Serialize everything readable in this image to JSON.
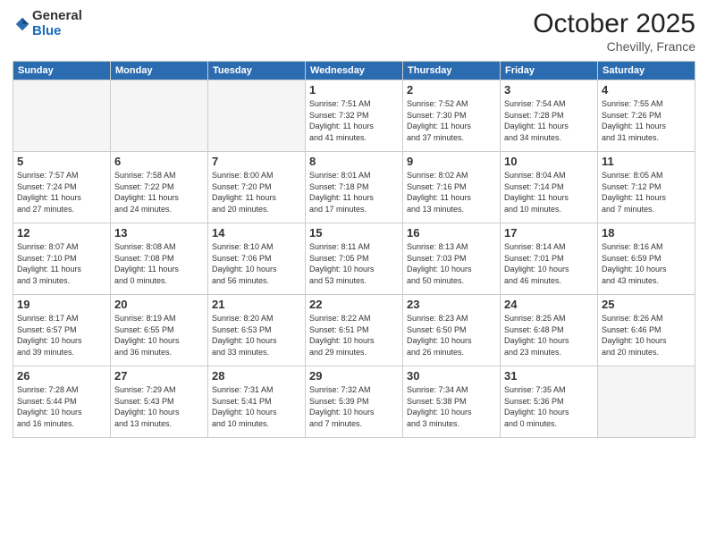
{
  "header": {
    "logo_line1": "General",
    "logo_line2": "Blue",
    "month": "October 2025",
    "location": "Chevilly, France"
  },
  "days_of_week": [
    "Sunday",
    "Monday",
    "Tuesday",
    "Wednesday",
    "Thursday",
    "Friday",
    "Saturday"
  ],
  "weeks": [
    [
      {
        "num": "",
        "info": ""
      },
      {
        "num": "",
        "info": ""
      },
      {
        "num": "",
        "info": ""
      },
      {
        "num": "1",
        "info": "Sunrise: 7:51 AM\nSunset: 7:32 PM\nDaylight: 11 hours\nand 41 minutes."
      },
      {
        "num": "2",
        "info": "Sunrise: 7:52 AM\nSunset: 7:30 PM\nDaylight: 11 hours\nand 37 minutes."
      },
      {
        "num": "3",
        "info": "Sunrise: 7:54 AM\nSunset: 7:28 PM\nDaylight: 11 hours\nand 34 minutes."
      },
      {
        "num": "4",
        "info": "Sunrise: 7:55 AM\nSunset: 7:26 PM\nDaylight: 11 hours\nand 31 minutes."
      }
    ],
    [
      {
        "num": "5",
        "info": "Sunrise: 7:57 AM\nSunset: 7:24 PM\nDaylight: 11 hours\nand 27 minutes."
      },
      {
        "num": "6",
        "info": "Sunrise: 7:58 AM\nSunset: 7:22 PM\nDaylight: 11 hours\nand 24 minutes."
      },
      {
        "num": "7",
        "info": "Sunrise: 8:00 AM\nSunset: 7:20 PM\nDaylight: 11 hours\nand 20 minutes."
      },
      {
        "num": "8",
        "info": "Sunrise: 8:01 AM\nSunset: 7:18 PM\nDaylight: 11 hours\nand 17 minutes."
      },
      {
        "num": "9",
        "info": "Sunrise: 8:02 AM\nSunset: 7:16 PM\nDaylight: 11 hours\nand 13 minutes."
      },
      {
        "num": "10",
        "info": "Sunrise: 8:04 AM\nSunset: 7:14 PM\nDaylight: 11 hours\nand 10 minutes."
      },
      {
        "num": "11",
        "info": "Sunrise: 8:05 AM\nSunset: 7:12 PM\nDaylight: 11 hours\nand 7 minutes."
      }
    ],
    [
      {
        "num": "12",
        "info": "Sunrise: 8:07 AM\nSunset: 7:10 PM\nDaylight: 11 hours\nand 3 minutes."
      },
      {
        "num": "13",
        "info": "Sunrise: 8:08 AM\nSunset: 7:08 PM\nDaylight: 11 hours\nand 0 minutes."
      },
      {
        "num": "14",
        "info": "Sunrise: 8:10 AM\nSunset: 7:06 PM\nDaylight: 10 hours\nand 56 minutes."
      },
      {
        "num": "15",
        "info": "Sunrise: 8:11 AM\nSunset: 7:05 PM\nDaylight: 10 hours\nand 53 minutes."
      },
      {
        "num": "16",
        "info": "Sunrise: 8:13 AM\nSunset: 7:03 PM\nDaylight: 10 hours\nand 50 minutes."
      },
      {
        "num": "17",
        "info": "Sunrise: 8:14 AM\nSunset: 7:01 PM\nDaylight: 10 hours\nand 46 minutes."
      },
      {
        "num": "18",
        "info": "Sunrise: 8:16 AM\nSunset: 6:59 PM\nDaylight: 10 hours\nand 43 minutes."
      }
    ],
    [
      {
        "num": "19",
        "info": "Sunrise: 8:17 AM\nSunset: 6:57 PM\nDaylight: 10 hours\nand 39 minutes."
      },
      {
        "num": "20",
        "info": "Sunrise: 8:19 AM\nSunset: 6:55 PM\nDaylight: 10 hours\nand 36 minutes."
      },
      {
        "num": "21",
        "info": "Sunrise: 8:20 AM\nSunset: 6:53 PM\nDaylight: 10 hours\nand 33 minutes."
      },
      {
        "num": "22",
        "info": "Sunrise: 8:22 AM\nSunset: 6:51 PM\nDaylight: 10 hours\nand 29 minutes."
      },
      {
        "num": "23",
        "info": "Sunrise: 8:23 AM\nSunset: 6:50 PM\nDaylight: 10 hours\nand 26 minutes."
      },
      {
        "num": "24",
        "info": "Sunrise: 8:25 AM\nSunset: 6:48 PM\nDaylight: 10 hours\nand 23 minutes."
      },
      {
        "num": "25",
        "info": "Sunrise: 8:26 AM\nSunset: 6:46 PM\nDaylight: 10 hours\nand 20 minutes."
      }
    ],
    [
      {
        "num": "26",
        "info": "Sunrise: 7:28 AM\nSunset: 5:44 PM\nDaylight: 10 hours\nand 16 minutes."
      },
      {
        "num": "27",
        "info": "Sunrise: 7:29 AM\nSunset: 5:43 PM\nDaylight: 10 hours\nand 13 minutes."
      },
      {
        "num": "28",
        "info": "Sunrise: 7:31 AM\nSunset: 5:41 PM\nDaylight: 10 hours\nand 10 minutes."
      },
      {
        "num": "29",
        "info": "Sunrise: 7:32 AM\nSunset: 5:39 PM\nDaylight: 10 hours\nand 7 minutes."
      },
      {
        "num": "30",
        "info": "Sunrise: 7:34 AM\nSunset: 5:38 PM\nDaylight: 10 hours\nand 3 minutes."
      },
      {
        "num": "31",
        "info": "Sunrise: 7:35 AM\nSunset: 5:36 PM\nDaylight: 10 hours\nand 0 minutes."
      },
      {
        "num": "",
        "info": ""
      }
    ]
  ]
}
